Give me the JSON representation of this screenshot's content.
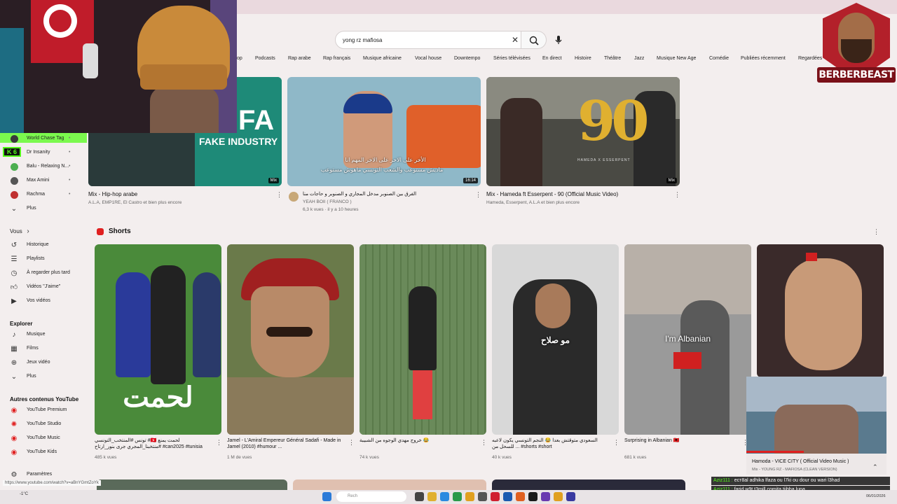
{
  "search": {
    "query": "yong rz mafiosa"
  },
  "chips": [
    "op",
    "Podcasts",
    "Rap arabe",
    "Rap français",
    "Musique africaine",
    "Vocal house",
    "Downtempo",
    "Séries télévisées",
    "En direct",
    "Histoire",
    "Théâtre",
    "Jazz",
    "Musique New Age",
    "Comédie",
    "Publiées récemment",
    "Regardées"
  ],
  "logo": {
    "text": "BERBERBEAST"
  },
  "sidebar": {
    "subscriptions": [
      {
        "label": "World Chase Tag",
        "color": "#3a3a3a"
      },
      {
        "label": "Dr Insanity",
        "color": "#2a6ad0"
      },
      {
        "label": "Balu - Relaxing N...",
        "color": "#4caf50"
      },
      {
        "label": "Max Amini",
        "color": "#555555"
      },
      {
        "label": "Rachma",
        "color": "#c03030"
      }
    ],
    "more": "Plus",
    "you_header": "Vous",
    "you_items": [
      "Historique",
      "Playlists",
      "À regarder plus tard",
      "Vidéos \"J'aime\"",
      "Vos vidéos"
    ],
    "explore_header": "Explorer",
    "explore_items": [
      "Musique",
      "Films",
      "Jeux vidéo",
      "Plus"
    ],
    "other_header": "Autres contenus YouTube",
    "other_items": [
      "YouTube Premium",
      "YouTube Studio",
      "YouTube Music",
      "YouTube Kids"
    ],
    "settings": "Paramètres",
    "kick_badge": "K 6"
  },
  "videos": [
    {
      "title": "Mix - Hip-hop arabe",
      "meta": "A.L.A, EMP1RE, El Castro et bien plus encore",
      "badge": "Mix",
      "thumb_text": "FAKE INDUSTRY",
      "thumb_big": "FA"
    },
    {
      "title": "الفرق بين الصنوبر مدخل المجاري و الصنوبر و حاجات منا",
      "channel": "YEAH BOII ( FRANCO )",
      "meta": "6,3 k vues · il y a 10 heures",
      "badge": "16:14",
      "caption1": "الأخر على الاخر على الاخر المهم انا",
      "caption2": "ماديش مستوعب والشعب التونسي ماهوش مستوعب"
    },
    {
      "title": "Mix - Hameda ft Esserpent - 90 (Official Music Video)",
      "meta": "Hameda, Esserpent, A.L.A et bien plus encore",
      "badge": "Mix",
      "thumb_big": "90",
      "thumb_small": "HAMEDA X ESSERPENT"
    }
  ],
  "shorts_header": "Shorts",
  "shorts": [
    {
      "title": "تونس #المنتخب_التونسي #🇹🇳 لحمت يمنع #منتخبنا_المجري جرى بنور_ارتاح #can2025 #tunisia",
      "views": "485 k vues",
      "overlay": "لحمت"
    },
    {
      "title": "Jamel - L'Amiral Empereur Général Sadafi - Made in Jamel (2010) #humour ...",
      "views": "1 M de vues",
      "overlay": ""
    },
    {
      "title": "خروج مهدي الوجوه من الشبيبة 😂",
      "views": "74 k vues",
      "overlay": ""
    },
    {
      "title": "السعودي متوقتش بعدا 😂 النجم التونسي يكون لاعبه للسحل من ... #shorts #short",
      "views": "40 k vues",
      "overlay": "مو صلاح"
    },
    {
      "title": "Surprising in Albanian 🇦🇱",
      "views": "681 k vues",
      "overlay": "I'm Albanian"
    },
    {
      "title": "",
      "views": "",
      "overlay": ""
    }
  ],
  "miniplayer": {
    "title": "Hamoda - VICE CITY ( Official Video Music )",
    "sub": "Mix - YOUNG RZ - MAFIOSA (CLEAN VERSION)"
  },
  "chat": [
    {
      "user": "Aziz111 :",
      "text": "ест8al adhika lfaza ou l7ki ou dour ou wari l3had"
    },
    {
      "user": "Aziz111 :",
      "text": "farid w9t t3mill comita tjibha luna"
    }
  ],
  "status_url": "https://www.youtube.com/watch?v=aBnYGmtZoYk",
  "taskbar": {
    "search": "Rech",
    "weather": "-1°C",
    "date": "06/01/2026"
  }
}
